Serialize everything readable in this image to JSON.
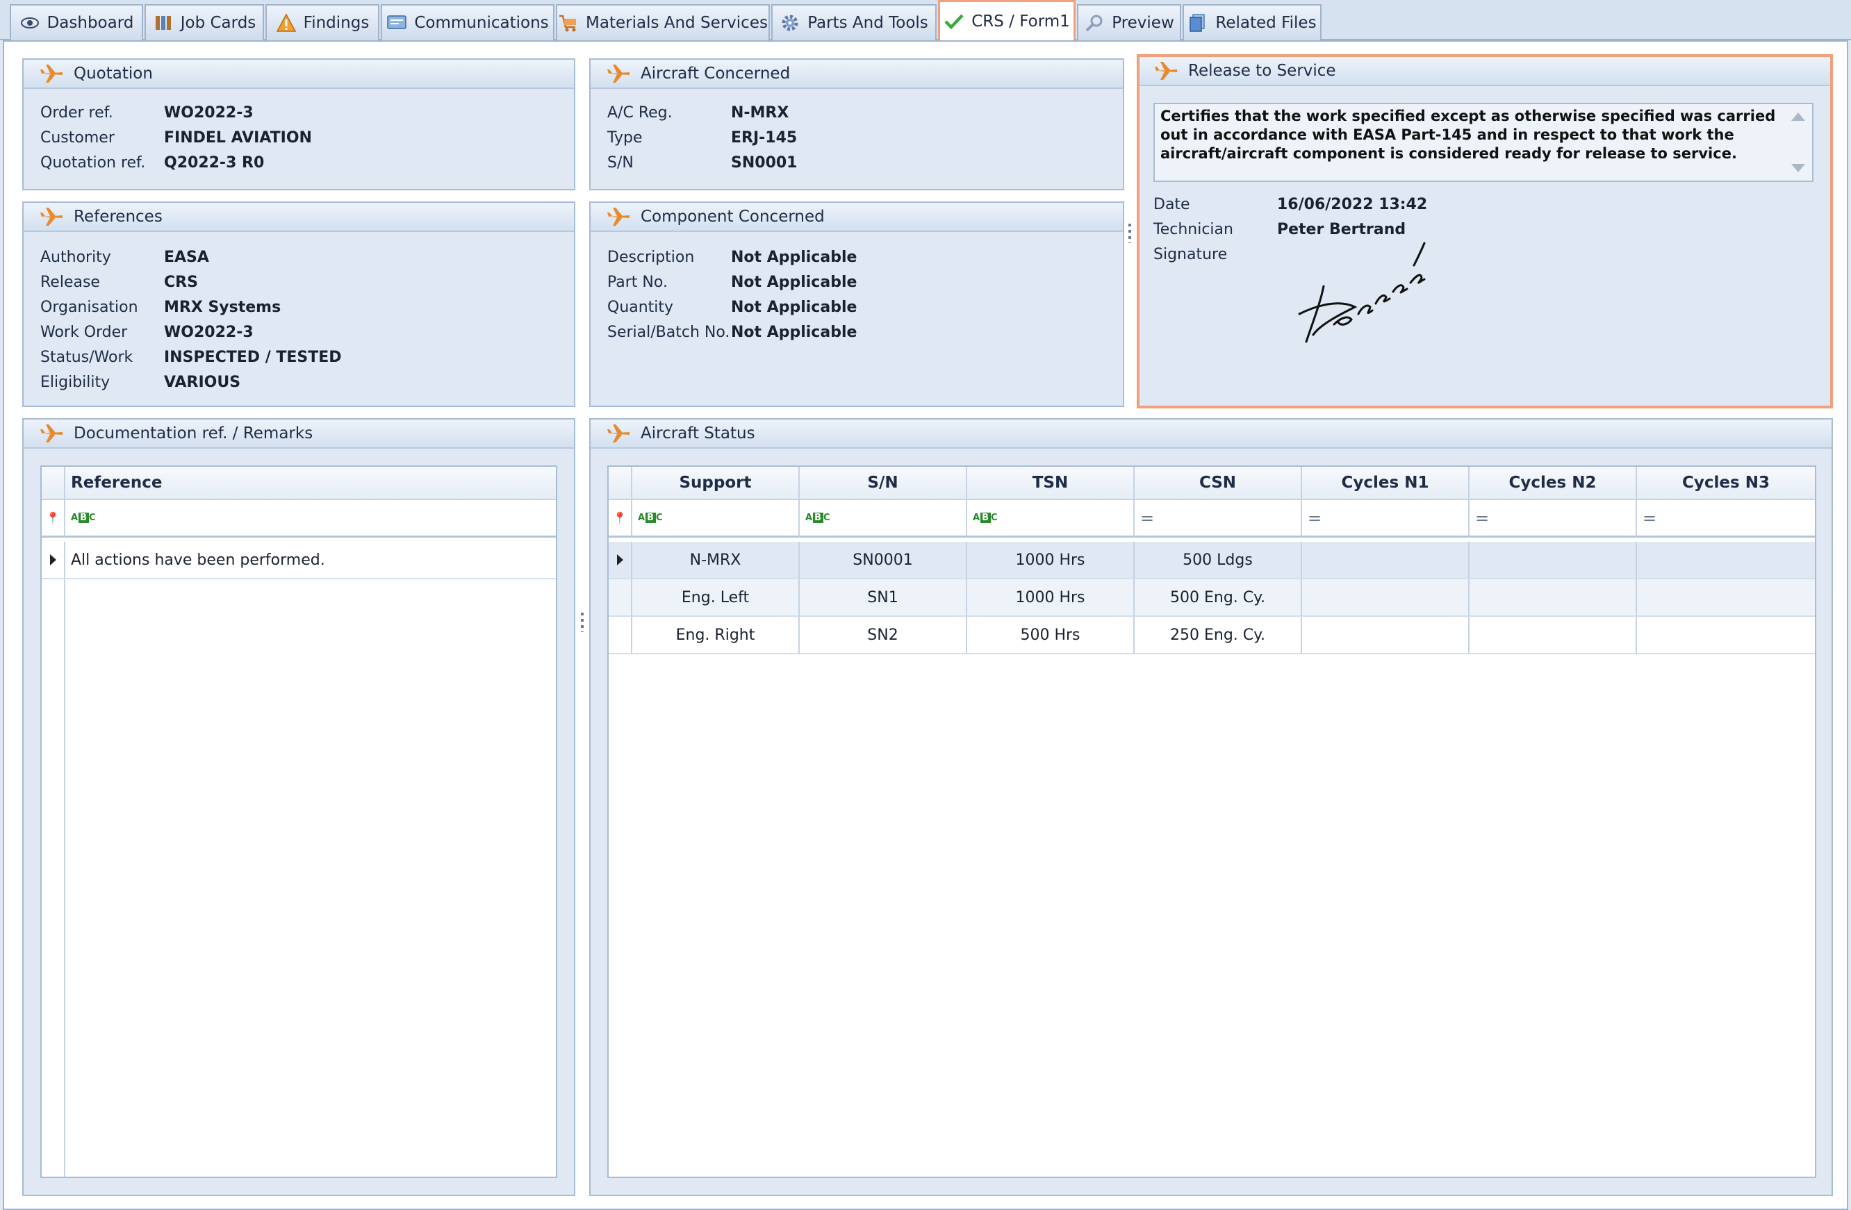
{
  "tabs": [
    {
      "label": "Dashboard",
      "icon": "eye-icon"
    },
    {
      "label": "Job Cards",
      "icon": "job-cards-icon"
    },
    {
      "label": "Findings",
      "icon": "warning-icon"
    },
    {
      "label": "Communications",
      "icon": "communications-icon"
    },
    {
      "label": "Materials And Services",
      "icon": "cart-icon"
    },
    {
      "label": "Parts And Tools",
      "icon": "gear-icon"
    },
    {
      "label": "CRS / Form1",
      "icon": "checkmark-icon",
      "active": true
    },
    {
      "label": "Preview",
      "icon": "magnifier-icon"
    },
    {
      "label": "Related Files",
      "icon": "files-icon"
    }
  ],
  "quotation": {
    "title": "Quotation",
    "rows": [
      {
        "label": "Order ref.",
        "value": "WO2022-3"
      },
      {
        "label": "Customer",
        "value": "FINDEL AVIATION"
      },
      {
        "label": "Quotation ref.",
        "value": "Q2022-3 R0"
      }
    ]
  },
  "aircraft_concerned": {
    "title": "Aircraft Concerned",
    "rows": [
      {
        "label": "A/C Reg.",
        "value": "N-MRX"
      },
      {
        "label": "Type",
        "value": "ERJ-145"
      },
      {
        "label": "S/N",
        "value": "SN0001"
      }
    ]
  },
  "references": {
    "title": "References",
    "rows": [
      {
        "label": "Authority",
        "value": "EASA"
      },
      {
        "label": "Release",
        "value": "CRS"
      },
      {
        "label": "Organisation",
        "value": "MRX Systems"
      },
      {
        "label": "Work Order",
        "value": "WO2022-3"
      },
      {
        "label": "Status/Work",
        "value": "INSPECTED / TESTED"
      },
      {
        "label": "Eligibility",
        "value": "VARIOUS"
      }
    ]
  },
  "component_concerned": {
    "title": "Component Concerned",
    "rows": [
      {
        "label": "Description",
        "value": "Not Applicable"
      },
      {
        "label": "Part No.",
        "value": "Not Applicable"
      },
      {
        "label": "Quantity",
        "value": "Not Applicable"
      },
      {
        "label": "Serial/Batch No.",
        "value": "Not Applicable"
      }
    ]
  },
  "release_to_service": {
    "title": "Release to Service",
    "statement": "Certifies that the work specified except as otherwise specified was carried out in accordance with EASA Part-145 and in respect to that work the aircraft/aircraft component is considered ready for release to service.",
    "rows": [
      {
        "label": "Date",
        "value": "16/06/2022 13:42"
      },
      {
        "label": "Technician",
        "value": "Peter Bertrand"
      },
      {
        "label": "Signature",
        "value": ""
      }
    ],
    "signature_text": "Bertrand"
  },
  "documentation": {
    "title": "Documentation ref. / Remarks",
    "column": "Reference",
    "rows": [
      "All actions have been performed."
    ]
  },
  "aircraft_status": {
    "title": "Aircraft Status",
    "columns": [
      "Support",
      "S/N",
      "TSN",
      "CSN",
      "Cycles N1",
      "Cycles N2",
      "Cycles N3"
    ],
    "rows": [
      [
        "N-MRX",
        "SN0001",
        "1000 Hrs",
        "500 Ldgs",
        "",
        "",
        ""
      ],
      [
        "Eng. Left",
        "SN1",
        "1000 Hrs",
        "500 Eng. Cy.",
        "",
        "",
        ""
      ],
      [
        "Eng. Right",
        "SN2",
        "500 Hrs",
        "250 Eng. Cy.",
        "",
        "",
        ""
      ]
    ]
  },
  "colors": {
    "accent_orange": "#f0a07c",
    "panel_bg": "#dfe8f3",
    "plane_icon": "#e8892c"
  }
}
